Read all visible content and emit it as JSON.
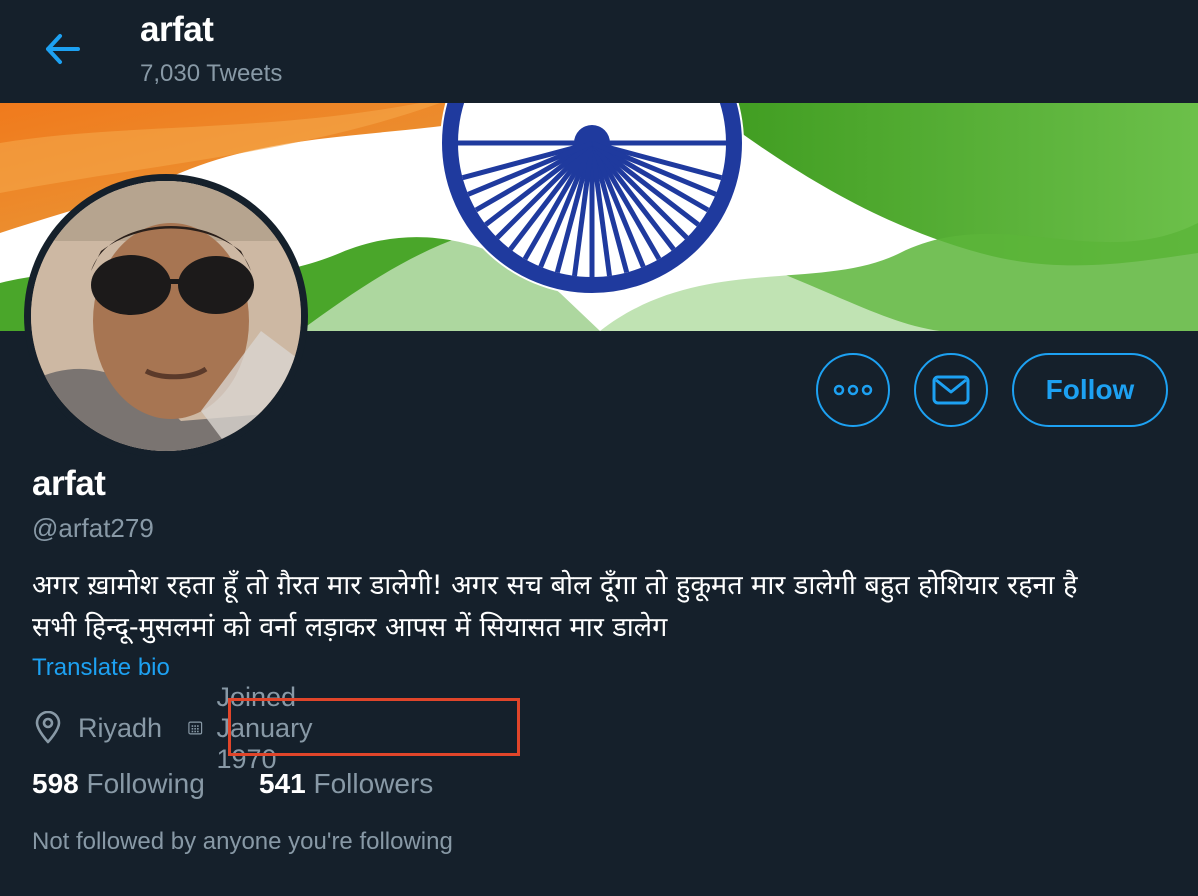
{
  "header": {
    "name": "arfat",
    "tweet_count": "7,030 Tweets"
  },
  "profile": {
    "display_name": "arfat",
    "handle": "@arfat279",
    "bio_line1": "अगर ख़ामोश रहता हूँ तो ग़ैरत मार डालेगी! अगर सच बोल दूँगा तो हुकूमत मार डालेगी बहुत होशियार रहना है",
    "bio_line2": "सभी हिन्दू-मुसलमां को वर्ना लड़ाकर आपस में सियासत मार डालेग",
    "translate_label": "Translate bio",
    "location": "Riyadh",
    "joined": "Joined January 1970",
    "following_count": "598",
    "following_label": "Following",
    "followers_count": "541",
    "followers_label": "Followers",
    "not_followed_text": "Not followed by anyone you're following"
  },
  "actions": {
    "follow_label": "Follow"
  },
  "colors": {
    "background": "#15202b",
    "accent": "#1da1f2",
    "muted": "#8899a6",
    "highlight_box": "#e0452a"
  },
  "icons": [
    "back-arrow-icon",
    "more-icon",
    "mail-icon",
    "location-pin-icon",
    "calendar-icon"
  ]
}
